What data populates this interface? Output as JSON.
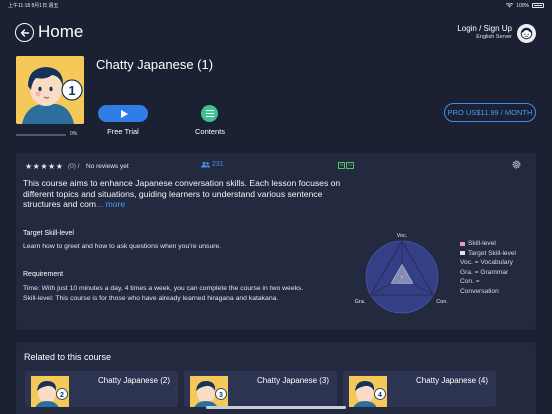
{
  "status_bar": {
    "time": "上午11:18  8月1日 週五",
    "battery": "100%"
  },
  "header": {
    "title": "Home",
    "login_label": "Login / Sign Up",
    "server_label": "English Server"
  },
  "course": {
    "title": "Chatty Japanese (1)",
    "progress_text": "0%",
    "progress_fraction": 0,
    "free_trial_label": "Free Trial",
    "contents_label": "Contents",
    "pro_button_label": "PRO US$11.99 / MONTH"
  },
  "details": {
    "stars": "★★★★★",
    "review_count": "(0) /",
    "no_reviews": "No reviews yet",
    "learner_count": "231",
    "badge_left": "lvl",
    "badge_right": "lvl",
    "description": "This course aims to enhance Japanese conversation skills. Each lesson focuses on different topics and situations, guiding learners to understand various sentence structures and com",
    "more_link": "... more",
    "target_skill_label": "Target Skill-level",
    "target_skill_text": "Learn how to greet and how to ask questions when you're unsure.",
    "requirement_label": "Requirement",
    "requirement_time": "Time: With just 10 minutes a day, 4 times a week, you can complete the course in two weeks.",
    "requirement_skill": "Skill-level: This course is for those who have already learned hiragana and katakana.",
    "radar": {
      "axis_voc": "Voc.",
      "axis_gra": "Gra.",
      "axis_con": "Con.",
      "skill_level": [
        0.05,
        0.05,
        0.05
      ],
      "target_level": [
        0.35,
        0.35,
        0.35
      ]
    },
    "legend": {
      "skill_level": "Skill-level",
      "target_skill_level": "Target Skill-level",
      "voc": "Voc. = Vocabulary",
      "gra": "Gra. = Grammar",
      "con": "Con. =",
      "con2": "Conversation"
    },
    "colors": {
      "skill": "#f28dd7",
      "target": "#dfe3ee",
      "accent": "#2f7ee6",
      "contents": "#3fc28f"
    }
  },
  "related": {
    "title": "Related to this course",
    "items": [
      {
        "name": "Chatty Japanese (2)",
        "badge": "2"
      },
      {
        "name": "Chatty Japanese (3)",
        "badge": "3"
      },
      {
        "name": "Chatty Japanese (4)",
        "badge": "4"
      }
    ]
  }
}
